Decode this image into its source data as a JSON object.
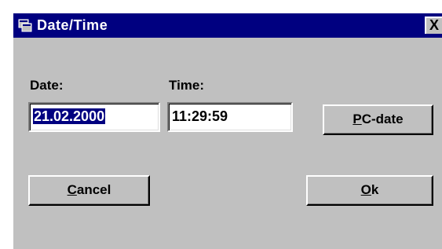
{
  "window": {
    "title": "Date/Time",
    "close_glyph": "X",
    "title_icon": "dialog-window-icon"
  },
  "date": {
    "label": "Date:",
    "value": "21.02.2000",
    "selected": true
  },
  "time": {
    "label": "Time:",
    "value": "11:29:59"
  },
  "buttons": {
    "pc_date": {
      "mnemonic": "P",
      "rest": "C-date"
    },
    "cancel": {
      "mnemonic": "C",
      "rest": "ancel"
    },
    "ok": {
      "mnemonic": "O",
      "rest": "k"
    }
  },
  "colors": {
    "titlebar": "#000080",
    "face": "#c0c0c0",
    "selection": "#000080"
  }
}
